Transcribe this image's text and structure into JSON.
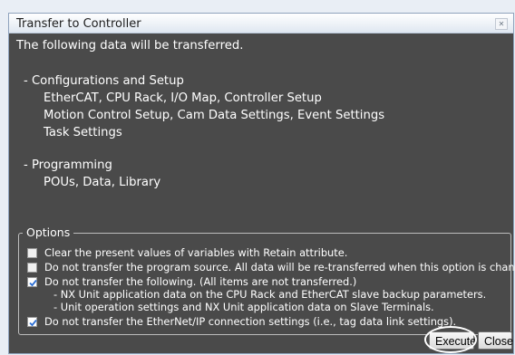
{
  "dialog": {
    "title": "Transfer to Controller",
    "intro": "The following data will be transferred.",
    "config_heading": "- Configurations and Setup",
    "config_items": [
      "EtherCAT, CPU Rack, I/O Map, Controller Setup",
      "Motion Control Setup, Cam Data Settings, Event Settings",
      "Task Settings"
    ],
    "programming_heading": "- Programming",
    "programming_items": [
      "POUs, Data, Library"
    ],
    "options_legend": "Options",
    "options": [
      {
        "label": "Clear the present values of variables with Retain attribute.",
        "checked": false
      },
      {
        "label": "Do not transfer the program source. All data will be re-transferred when this option is changed.",
        "checked": false
      },
      {
        "label": "Do not transfer the following. (All items are not transferred.)",
        "checked": true
      },
      {
        "label": "Do not transfer the EtherNet/IP connection settings (i.e., tag data link settings).",
        "checked": true
      }
    ],
    "sub_notes": [
      "- NX Unit application data on the CPU Rack and EtherCAT slave backup parameters.",
      "- Unit operation settings and NX Unit application data on Slave Terminals."
    ],
    "execute_label": "Execute",
    "close_label": "Close"
  },
  "colors": {
    "dialog_background": "#4a4a4a",
    "checkbox_check": "#2d6fd3"
  }
}
